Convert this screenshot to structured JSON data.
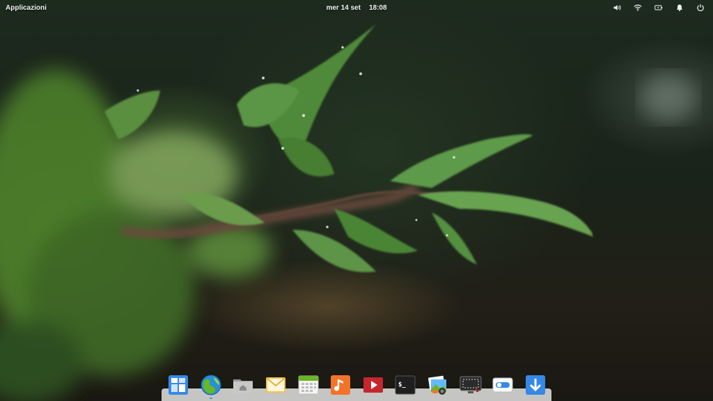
{
  "top_panel": {
    "applications_label": "Applicazioni",
    "date": "mer 14 set",
    "time": "18:08",
    "indicators": [
      "volume-icon",
      "wifi-icon",
      "battery-icon",
      "notifications-icon",
      "power-icon"
    ]
  },
  "dock": {
    "items": [
      {
        "name": "multitasking-view-icon",
        "running": false
      },
      {
        "name": "web-browser-icon",
        "running": true
      },
      {
        "name": "files-icon",
        "running": false
      },
      {
        "name": "mail-icon",
        "running": false
      },
      {
        "name": "calendar-icon",
        "running": false
      },
      {
        "name": "music-icon",
        "running": false
      },
      {
        "name": "videos-icon",
        "running": false
      },
      {
        "name": "terminal-icon",
        "running": false
      },
      {
        "name": "photos-icon",
        "running": false
      },
      {
        "name": "screenshot-icon",
        "running": false
      },
      {
        "name": "system-settings-icon",
        "running": false
      },
      {
        "name": "appcenter-icon",
        "running": false
      }
    ],
    "accent_color": "#3a9bdc"
  }
}
